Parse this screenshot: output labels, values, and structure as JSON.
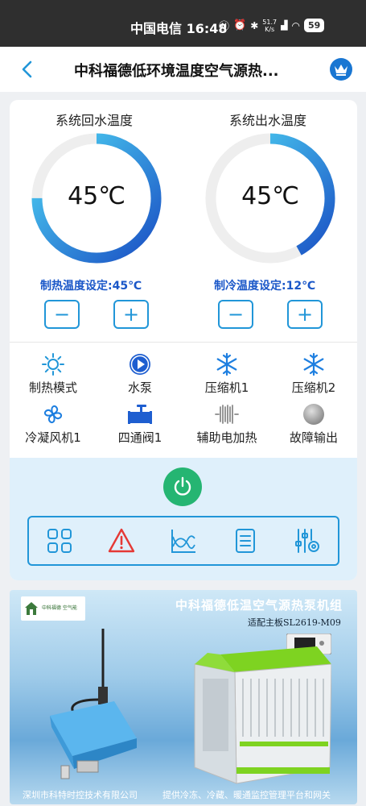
{
  "status_bar": {
    "carrier_time": "中国电信 16:48",
    "net_speed_value": "51.7",
    "net_speed_unit": "K/s",
    "battery": "59"
  },
  "nav": {
    "title": "中科福德低环境温度空气源热..."
  },
  "gauges": [
    {
      "title": "系统回水温度",
      "value": "45℃",
      "fill_fraction": 0.75
    },
    {
      "title": "系统出水温度",
      "value": "45℃",
      "fill_fraction": 0.42
    }
  ],
  "setpoints": {
    "heating": "制热温度设定:45℃",
    "cooling": "制冷温度设定:12℃",
    "minus": "−",
    "plus": "+"
  },
  "status_items": [
    {
      "label": "制热模式",
      "icon": "sun-icon"
    },
    {
      "label": "水泵",
      "icon": "pump-play-icon"
    },
    {
      "label": "压缩机1",
      "icon": "snowflake-icon"
    },
    {
      "label": "压缩机2",
      "icon": "snowflake-icon"
    },
    {
      "label": "冷凝风机1",
      "icon": "fan-icon"
    },
    {
      "label": "四通阀1",
      "icon": "valve-icon"
    },
    {
      "label": "辅助电加热",
      "icon": "heater-icon"
    },
    {
      "label": "故障输出",
      "icon": "fault-indicator-icon"
    }
  ],
  "toolbar": [
    "grid-icon",
    "alarm-icon",
    "curve-chart-icon",
    "list-icon",
    "settings-sliders-icon"
  ],
  "banner": {
    "title": "中科福德低温空气源热泵机组",
    "subtitle": "适配主板SL2619-M09",
    "footer_left": "深圳市科特时控技术有限公司",
    "footer_right": "提供冷冻、冷藏、暖通监控管理平台和网关",
    "logo_text": "中科福德 空气能"
  },
  "colors": {
    "accent": "#2196d8",
    "setpoint_text": "#1a57c8",
    "power": "#25b572",
    "alarm": "#e53935",
    "controls_bg": "#dff0fb"
  }
}
